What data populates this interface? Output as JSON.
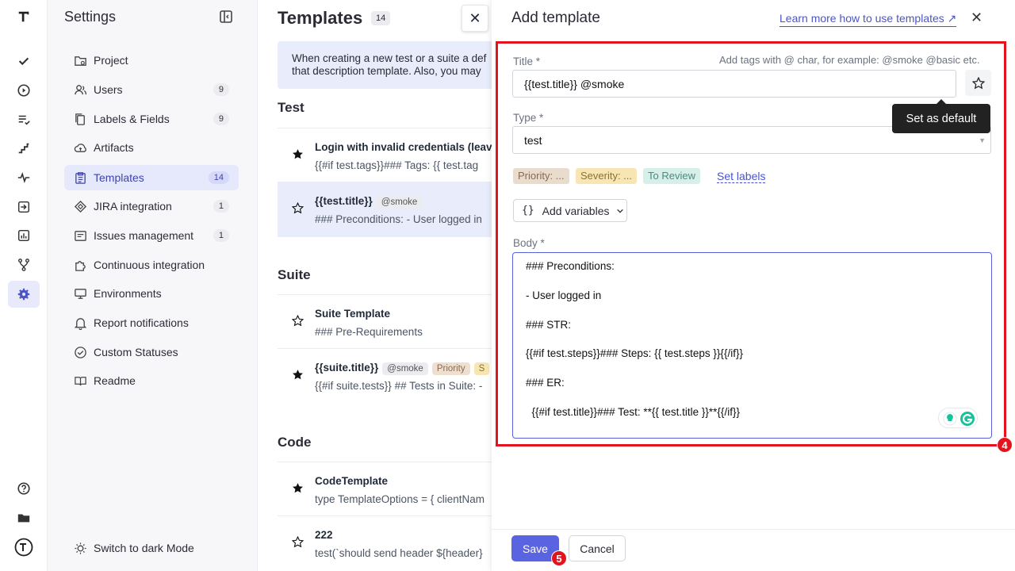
{
  "settings": {
    "title": "Settings",
    "items": [
      {
        "label": "Project",
        "count": ""
      },
      {
        "label": "Users",
        "count": "9"
      },
      {
        "label": "Labels & Fields",
        "count": "9"
      },
      {
        "label": "Artifacts",
        "count": ""
      },
      {
        "label": "Templates",
        "count": "14"
      },
      {
        "label": "JIRA integration",
        "count": "1"
      },
      {
        "label": "Issues management",
        "count": "1"
      },
      {
        "label": "Continuous integration",
        "count": ""
      },
      {
        "label": "Environments",
        "count": ""
      },
      {
        "label": "Report notifications",
        "count": ""
      },
      {
        "label": "Custom Statuses",
        "count": ""
      },
      {
        "label": "Readme",
        "count": ""
      }
    ],
    "dark_mode": "Switch to dark Mode"
  },
  "templates": {
    "title": "Templates",
    "count": "14",
    "info_line1": "When creating a new test or a suite a def",
    "info_line2": "that description template. Also, you may",
    "sections": {
      "test": "Test",
      "suite": "Suite",
      "code": "Code"
    },
    "test_rows": [
      {
        "title": "Login with invalid credentials (leave",
        "body": "{{#if test.tags}}### Tags: {{ test.tag"
      },
      {
        "title": "{{test.title}}",
        "tag": "@smoke",
        "body": "### Preconditions: - User logged in"
      }
    ],
    "suite_rows": [
      {
        "title": "Suite Template",
        "body": "### Pre-Requirements"
      },
      {
        "title": "{{suite.title}}",
        "tag": "@smoke",
        "tag2": "Priority",
        "tag3": "S",
        "body": "{{#if suite.tests}} ## Tests in Suite: -"
      }
    ],
    "code_rows": [
      {
        "title": "CodeTemplate",
        "body": "type TemplateOptions = { clientNam"
      },
      {
        "title": "222",
        "body": "test(`should send header ${header}"
      }
    ]
  },
  "drawer": {
    "title": "Add template",
    "learn_link": "Learn more how to use templates ↗",
    "title_label": "Title *",
    "title_hint": "Add tags with @ char, for example: @smoke @basic etc.",
    "title_value": "{{test.title}} @smoke",
    "tooltip": "Set as default",
    "type_label": "Type *",
    "type_value": "test",
    "labels": {
      "priority": "Priority: ...",
      "severity": "Severity: ...",
      "review": "To Review",
      "set_labels": "Set labels"
    },
    "add_variables": "Add variables",
    "add_variables_icon": "{}",
    "body_label": "Body *",
    "body_lines": [
      "### Preconditions:",
      "",
      "- User logged in",
      "",
      "### STR:",
      "",
      "{{#if test.steps}}### Steps: {{ test.steps }}{{/if}}",
      "",
      "### ER:",
      "",
      "  {{#if test.title}}### Test: **{{ test.title }}**{{/if}}"
    ],
    "save": "Save",
    "cancel": "Cancel",
    "marker_box": "4",
    "marker_save": "5"
  },
  "colors": {
    "accent": "#5a63e0",
    "annotation_red": "#e3141e",
    "active_bg": "#e6e8fb"
  }
}
